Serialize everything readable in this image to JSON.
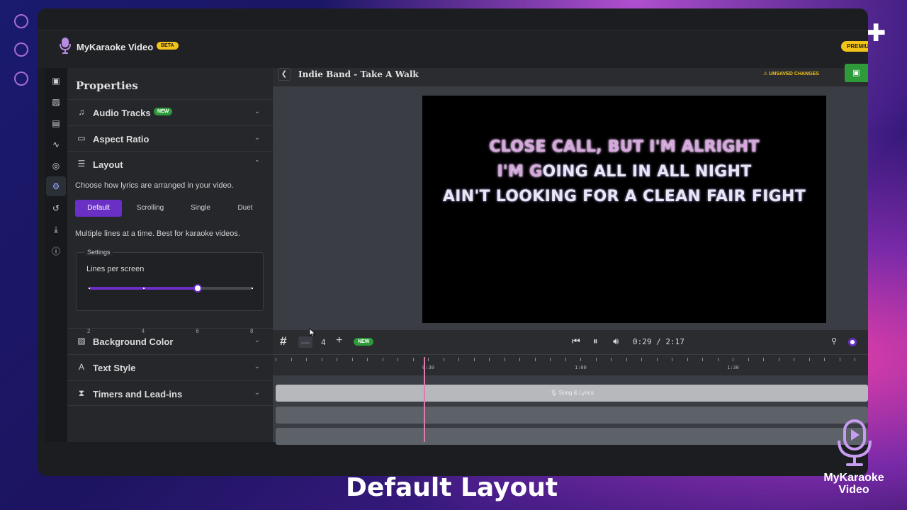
{
  "app": {
    "title": "MyKaraoke Video",
    "beta_badge": "BETA",
    "premium_badge": "PREMIUM"
  },
  "panel": {
    "title": "Properties",
    "sections": {
      "audio": {
        "label": "Audio Tracks",
        "badge": "NEW"
      },
      "aspect": {
        "label": "Aspect Ratio"
      },
      "layout": {
        "label": "Layout"
      },
      "background": {
        "label": "Background Color"
      },
      "text_style": {
        "label": "Text Style"
      },
      "timers": {
        "label": "Timers and Lead-ins"
      }
    },
    "layout_desc": "Choose how lyrics are arranged in your video.",
    "layout_options": [
      "Default",
      "Scrolling",
      "Single",
      "Duet"
    ],
    "layout_selected": "Default",
    "layout_note": "Multiple lines at a time. Best for karaoke videos.",
    "settings": {
      "legend": "Settings",
      "lines_label": "Lines per screen",
      "slider_ticks": [
        "2",
        "4",
        "6",
        "8"
      ],
      "slider_value": 6
    }
  },
  "editor": {
    "project_title": "Indie Band - Take A Walk",
    "unsaved_label": "UNSAVED CHANGES",
    "lyrics": {
      "line1": "CLOSE CALL, BUT I'M ALRIGHT",
      "line2_sung": "I'M G",
      "line2_rest": "OING ALL IN ALL NIGHT",
      "line3": "AIN'T LOOKING FOR A CLEAN FAIR FIGHT"
    },
    "timeline": {
      "lines_count": "4",
      "new_badge": "NEW",
      "time_current": "0:29",
      "time_separator": "/",
      "time_total": "2:17",
      "ruler_labels": [
        "0:30",
        "1:00",
        "1:30"
      ],
      "song_track_label": "Song & Lyrics"
    }
  },
  "caption": "Default Layout",
  "brand": {
    "line1": "MyKaraoke",
    "line2": "Video"
  },
  "colors": {
    "accent": "#6a2fc4",
    "badge_yellow": "#f2c318",
    "badge_green": "#2e9a3a",
    "playhead": "#e07ab0"
  }
}
